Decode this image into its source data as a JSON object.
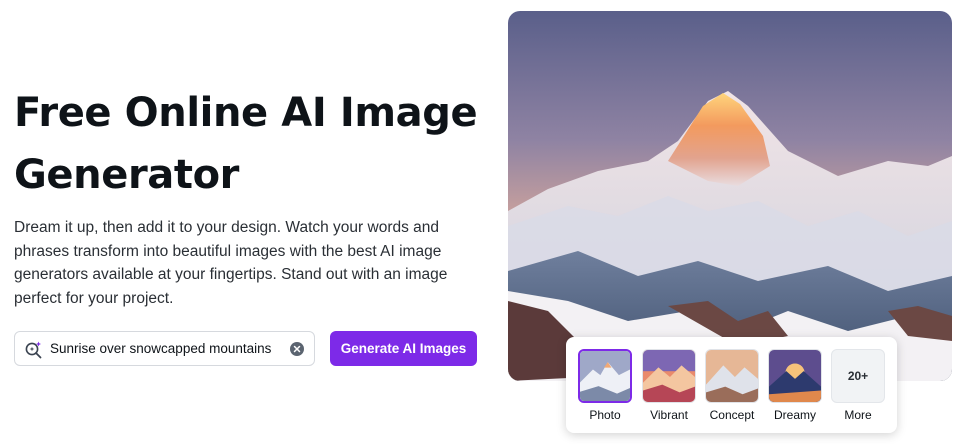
{
  "hero": {
    "title": "Free Online AI Image Generator",
    "description": "Dream it up, then add it to your design. Watch your words and phrases transform into beautiful images with the best AI image generators available at your fingertips. Stand out with an image perfect for your project."
  },
  "search": {
    "value": "Sunrise over snowcapped mountains",
    "icon": "magic-search-icon",
    "clear_icon": "clear-icon"
  },
  "generate_button": {
    "label": "Generate AI Images",
    "color": "#7d2ae8"
  },
  "image_alt": "Snowcapped mountain at sunrise",
  "styles": {
    "selected": "Photo",
    "items": [
      {
        "label": "Photo"
      },
      {
        "label": "Vibrant"
      },
      {
        "label": "Concept"
      },
      {
        "label": "Dreamy"
      },
      {
        "label": "More",
        "badge": "20+"
      }
    ]
  }
}
